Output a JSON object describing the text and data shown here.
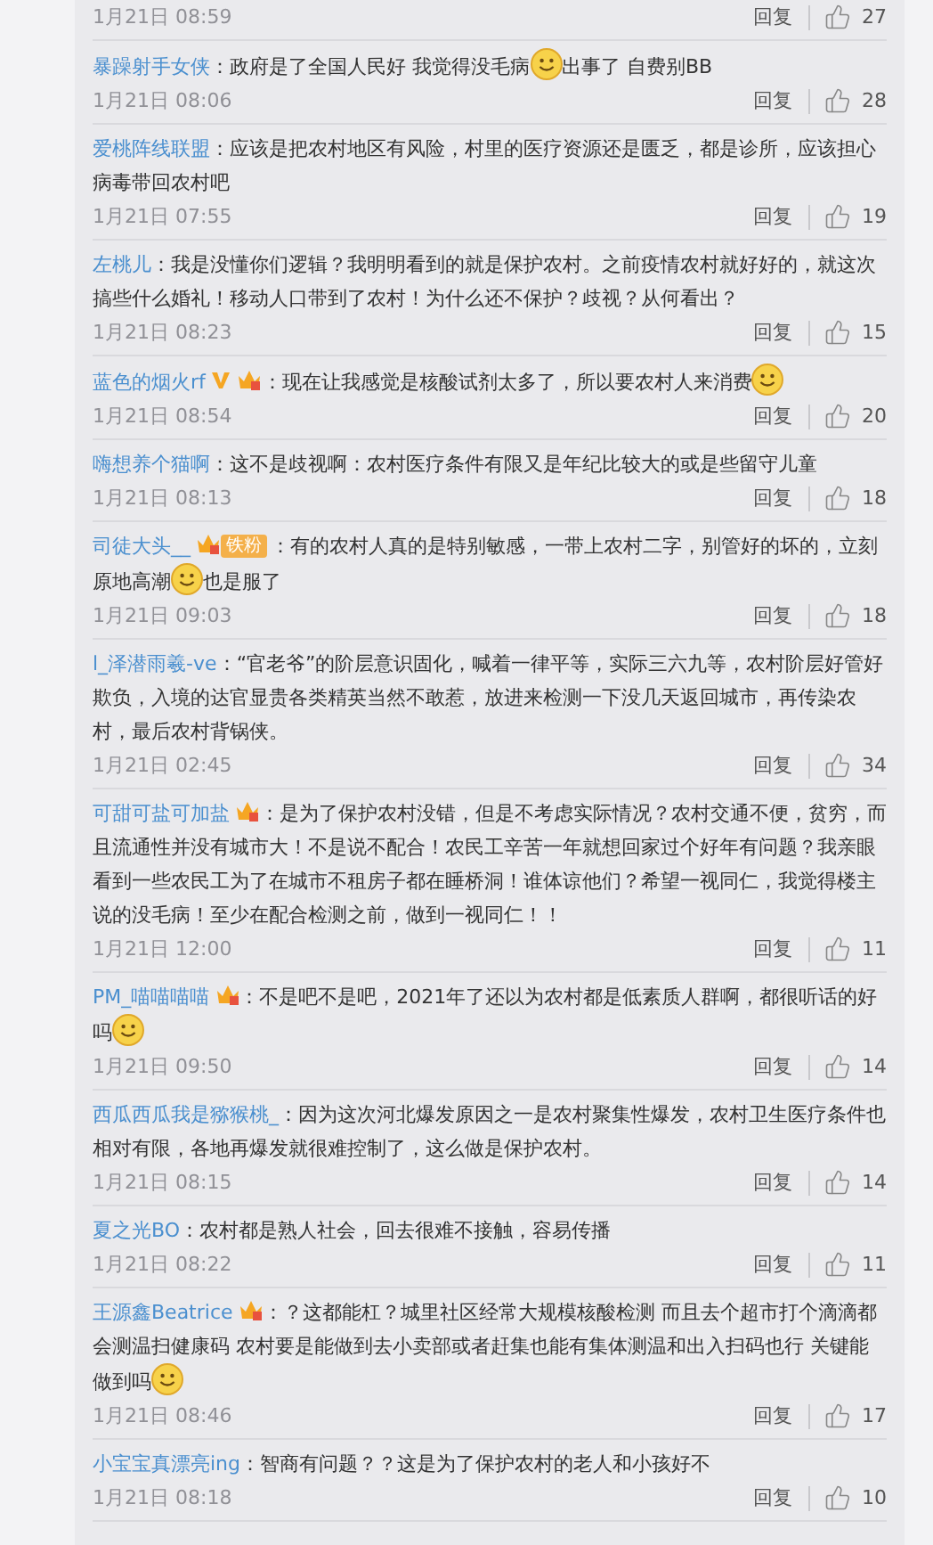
{
  "partial_top": {
    "time": "1月21日 08:59",
    "reply": "回复",
    "likes": "27"
  },
  "comments": [
    {
      "name": "暴躁射手女侠",
      "parts": [
        {
          "kind": "text",
          "text": "：政府是了全国人民好 我觉得没毛病"
        },
        {
          "kind": "emoji"
        },
        {
          "kind": "text",
          "text": "出事了 自费别BB"
        }
      ],
      "time": "1月21日 08:06",
      "reply": "回复",
      "likes": "28"
    },
    {
      "name": "爱桃阵线联盟",
      "parts": [
        {
          "kind": "text",
          "text": "：应该是把农村地区有风险，村里的医疗资源还是匮乏，都是诊所，应该担心病毒带回农村吧"
        }
      ],
      "time": "1月21日 07:55",
      "reply": "回复",
      "likes": "19"
    },
    {
      "name": "左桃儿",
      "parts": [
        {
          "kind": "text",
          "text": "：我是没懂你们逻辑？我明明看到的就是保护农村。之前疫情农村就好好的，就这次搞些什么婚礼！移动人口带到了农村！为什么还不保护？歧视？从何看出？"
        }
      ],
      "time": "1月21日 08:23",
      "reply": "回复",
      "likes": "15"
    },
    {
      "name": "蓝色的烟火rf",
      "badges": [
        {
          "kind": "vip"
        },
        {
          "kind": "crown"
        }
      ],
      "parts": [
        {
          "kind": "text",
          "text": "：现在让我感觉是核酸试剂太多了，所以要农村人来消费"
        },
        {
          "kind": "emoji"
        }
      ],
      "time": "1月21日 08:54",
      "reply": "回复",
      "likes": "20"
    },
    {
      "name": "嗨想养个猫啊",
      "parts": [
        {
          "kind": "text",
          "text": "：这不是歧视啊：农村医疗条件有限又是年纪比较大的或是些留守儿童"
        }
      ],
      "time": "1月21日 08:13",
      "reply": "回复",
      "likes": "18"
    },
    {
      "name": "司徒大头__",
      "badges": [
        {
          "kind": "crown"
        },
        {
          "kind": "fan",
          "text": "铁粉"
        }
      ],
      "parts": [
        {
          "kind": "text",
          "text": "：有的农村人真的是特别敏感，一带上农村二字，别管好的坏的，立刻原地高潮"
        },
        {
          "kind": "emoji"
        },
        {
          "kind": "text",
          "text": "也是服了"
        }
      ],
      "time": "1月21日 09:03",
      "reply": "回复",
      "likes": "18"
    },
    {
      "name": "l_泽潜雨羲-ve",
      "parts": [
        {
          "kind": "text",
          "text": "：“官老爷”的阶层意识固化，喊着一律平等，实际三六九等，农村阶层好管好欺负，入境的达官显贵各类精英当然不敢惹，放进来检测一下没几天返回城市，再传染农村，最后农村背锅侠。"
        }
      ],
      "time": "1月21日 02:45",
      "reply": "回复",
      "likes": "34"
    },
    {
      "name": "可甜可盐可加盐",
      "badges": [
        {
          "kind": "crown"
        }
      ],
      "parts": [
        {
          "kind": "text",
          "text": "：是为了保护农村没错，但是不考虑实际情况？农村交通不便，贫穷，而且流通性并没有城市大！不是说不配合！农民工辛苦一年就想回家过个好年有问题？我亲眼看到一些农民工为了在城市不租房子都在睡桥洞！谁体谅他们？希望一视同仁，我觉得楼主说的没毛病！至少在配合检测之前，做到一视同仁！！"
        }
      ],
      "time": "1月21日 12:00",
      "reply": "回复",
      "likes": "11"
    },
    {
      "name": "PM_喵喵喵喵",
      "badges": [
        {
          "kind": "crown"
        }
      ],
      "parts": [
        {
          "kind": "text",
          "text": "：不是吧不是吧，2021年了还以为农村都是低素质人群啊，都很听话的好吗"
        },
        {
          "kind": "emoji"
        }
      ],
      "time": "1月21日 09:50",
      "reply": "回复",
      "likes": "14"
    },
    {
      "name": "西瓜西瓜我是猕猴桃_",
      "parts": [
        {
          "kind": "text",
          "text": "：因为这次河北爆发原因之一是农村聚集性爆发，农村卫生医疗条件也相对有限，各地再爆发就很难控制了，这么做是保护农村。"
        }
      ],
      "time": "1月21日 08:15",
      "reply": "回复",
      "likes": "14"
    },
    {
      "name": "夏之光BO",
      "parts": [
        {
          "kind": "text",
          "text": "：农村都是熟人社会，回去很难不接触，容易传播"
        }
      ],
      "time": "1月21日 08:22",
      "reply": "回复",
      "likes": "11"
    },
    {
      "name": "王源鑫Beatrice",
      "badges": [
        {
          "kind": "crown"
        }
      ],
      "parts": [
        {
          "kind": "text",
          "text": "：？这都能杠？城里社区经常大规模核酸检测 而且去个超市打个滴滴都会测温扫健康码 农村要是能做到去小卖部或者赶集也能有集体测温和出入扫码也行 关键能做到吗"
        },
        {
          "kind": "emoji"
        }
      ],
      "time": "1月21日 08:46",
      "reply": "回复",
      "likes": "17"
    },
    {
      "name": "小宝宝真漂亮ing",
      "parts": [
        {
          "kind": "text",
          "text": "：智商有问题？？这是为了保护农村的老人和小孩好不"
        }
      ],
      "time": "1月21日 08:18",
      "reply": "回复",
      "likes": "10"
    }
  ]
}
